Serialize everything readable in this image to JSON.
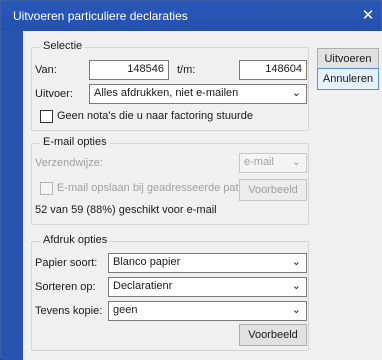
{
  "window": {
    "title": "Uitvoeren particuliere declaraties",
    "close_glyph": "✕"
  },
  "buttons": {
    "execute": "Uitvoeren",
    "cancel": "Annuleren"
  },
  "selectie": {
    "title": "Selectie",
    "from_label": "Van:",
    "from_value": "148546",
    "to_label": "t/m:",
    "to_value": "148604",
    "output_label": "Uitvoer:",
    "output_value": "Alles afdrukken, niet e-mailen",
    "factoring_label": "Geen nota's die u naar factoring stuurde"
  },
  "email": {
    "title": "E-mail opties",
    "method_label": "Verzendwijze:",
    "method_value": "e-mail",
    "save_label": "E-mail opslaan bij geadresseerde patient",
    "preview_label": "Voorbeeld",
    "status_text": "52 van 59 (88%) geschikt voor e-mail"
  },
  "print": {
    "title": "Afdruk opties",
    "paper_label": "Papier soort:",
    "paper_value": "Blanco papier",
    "sort_label": "Sorteren op:",
    "sort_value": "Declaratienr",
    "copy_label": "Tevens kopie:",
    "copy_value": "geen",
    "preview_label": "Voorbeeld"
  },
  "icons": {
    "dropdown": "chevron-down-icon",
    "close": "close-icon"
  }
}
